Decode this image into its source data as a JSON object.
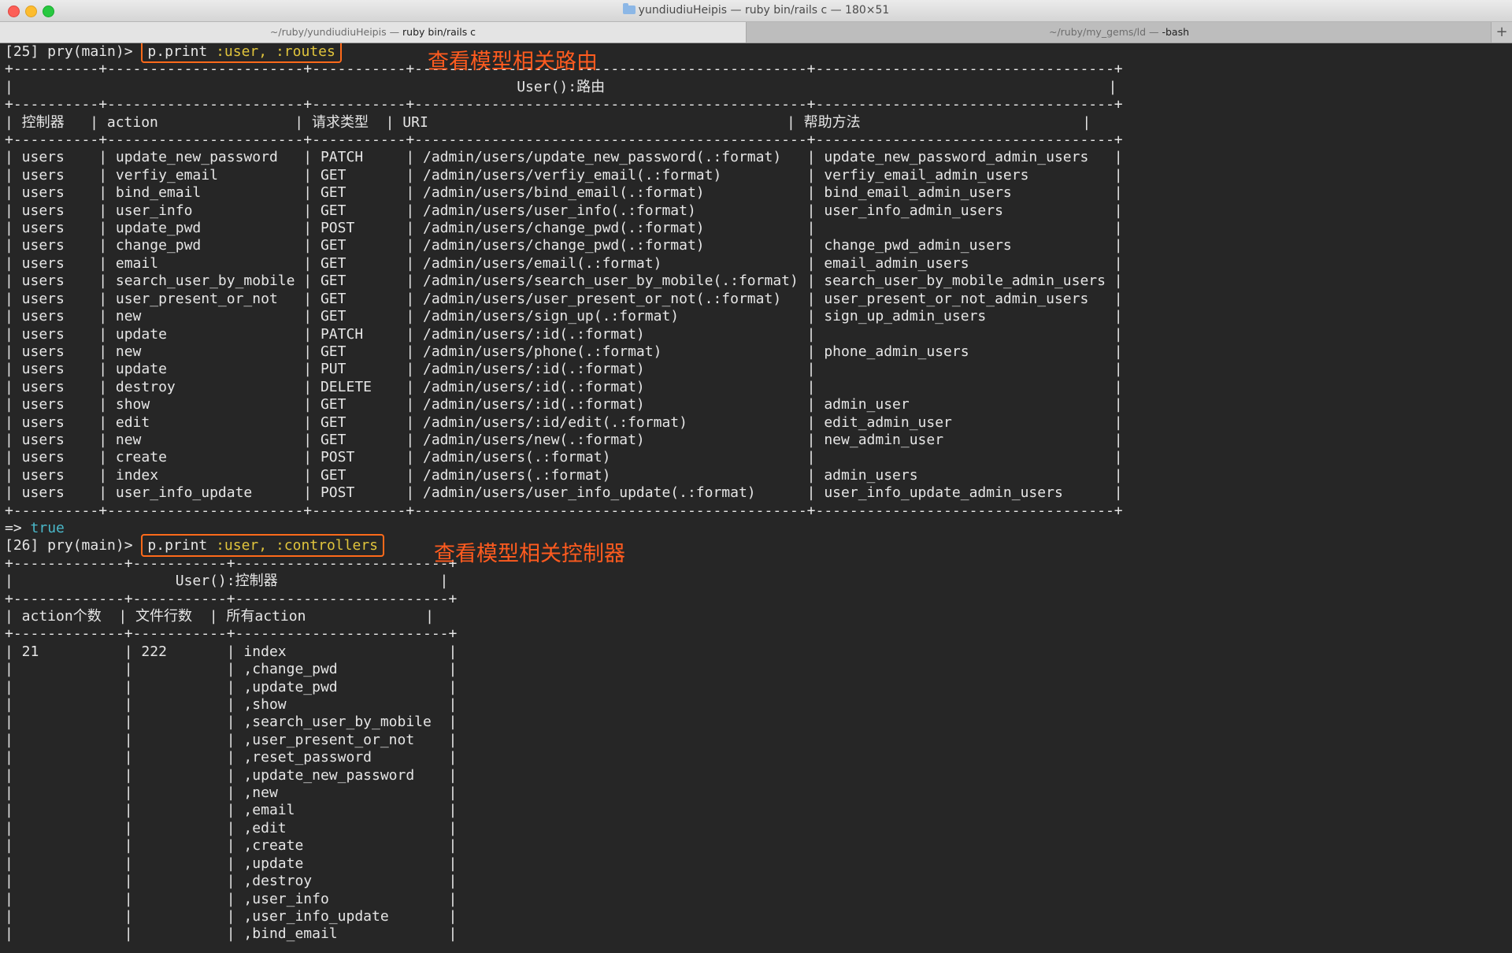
{
  "window": {
    "title": "yundiudiuHeipis — ruby bin/rails c — 180×51",
    "tabs": [
      {
        "path": "~/ruby/yundiudiuHeipis — ",
        "process": "ruby bin/rails c"
      },
      {
        "path": "~/ruby/my_gems/ld — ",
        "process": "-bash"
      }
    ],
    "new_tab": "+"
  },
  "annotations": {
    "routes": "查看模型相关路由",
    "controllers": "查看模型相关控制器"
  },
  "prompts": [
    {
      "prefix": "[25] pry(main)> ",
      "cmd": "p.print",
      "args": " :user, :routes"
    },
    {
      "prefix": "[26] pry(main)> ",
      "cmd": "p.print",
      "args": " :user, :controllers"
    }
  ],
  "result": {
    "arrow": "=> ",
    "value": "true"
  },
  "routes_table": {
    "title": "User():路由",
    "headers": [
      "控制器",
      "action",
      "请求类型",
      "URI",
      "帮助方法"
    ],
    "rows": [
      [
        "users",
        "update_new_password",
        "PATCH",
        "/admin/users/update_new_password(.:format)",
        "update_new_password_admin_users"
      ],
      [
        "users",
        "verfiy_email",
        "GET",
        "/admin/users/verfiy_email(.:format)",
        "verfiy_email_admin_users"
      ],
      [
        "users",
        "bind_email",
        "GET",
        "/admin/users/bind_email(.:format)",
        "bind_email_admin_users"
      ],
      [
        "users",
        "user_info",
        "GET",
        "/admin/users/user_info(.:format)",
        "user_info_admin_users"
      ],
      [
        "users",
        "update_pwd",
        "POST",
        "/admin/users/change_pwd(.:format)",
        ""
      ],
      [
        "users",
        "change_pwd",
        "GET",
        "/admin/users/change_pwd(.:format)",
        "change_pwd_admin_users"
      ],
      [
        "users",
        "email",
        "GET",
        "/admin/users/email(.:format)",
        "email_admin_users"
      ],
      [
        "users",
        "search_user_by_mobile",
        "GET",
        "/admin/users/search_user_by_mobile(.:format)",
        "search_user_by_mobile_admin_users"
      ],
      [
        "users",
        "user_present_or_not",
        "GET",
        "/admin/users/user_present_or_not(.:format)",
        "user_present_or_not_admin_users"
      ],
      [
        "users",
        "new",
        "GET",
        "/admin/users/sign_up(.:format)",
        "sign_up_admin_users"
      ],
      [
        "users",
        "update",
        "PATCH",
        "/admin/users/:id(.:format)",
        ""
      ],
      [
        "users",
        "new",
        "GET",
        "/admin/users/phone(.:format)",
        "phone_admin_users"
      ],
      [
        "users",
        "update",
        "PUT",
        "/admin/users/:id(.:format)",
        ""
      ],
      [
        "users",
        "destroy",
        "DELETE",
        "/admin/users/:id(.:format)",
        ""
      ],
      [
        "users",
        "show",
        "GET",
        "/admin/users/:id(.:format)",
        "admin_user"
      ],
      [
        "users",
        "edit",
        "GET",
        "/admin/users/:id/edit(.:format)",
        "edit_admin_user"
      ],
      [
        "users",
        "new",
        "GET",
        "/admin/users/new(.:format)",
        "new_admin_user"
      ],
      [
        "users",
        "create",
        "POST",
        "/admin/users(.:format)",
        ""
      ],
      [
        "users",
        "index",
        "GET",
        "/admin/users(.:format)",
        "admin_users"
      ],
      [
        "users",
        "user_info_update",
        "POST",
        "/admin/users/user_info_update(.:format)",
        "user_info_update_admin_users"
      ]
    ]
  },
  "controllers_table": {
    "title": "User():控制器",
    "headers": [
      "action个数",
      "文件行数",
      "所有action"
    ],
    "action_count": "21",
    "file_lines": "222",
    "actions": [
      "index",
      ",change_pwd",
      ",update_pwd",
      ",show",
      ",search_user_by_mobile",
      ",user_present_or_not",
      ",reset_password",
      ",update_new_password",
      ",new",
      ",email",
      ",edit",
      ",create",
      ",update",
      ",destroy",
      ",user_info",
      ",user_info_update",
      ",bind_email"
    ]
  }
}
